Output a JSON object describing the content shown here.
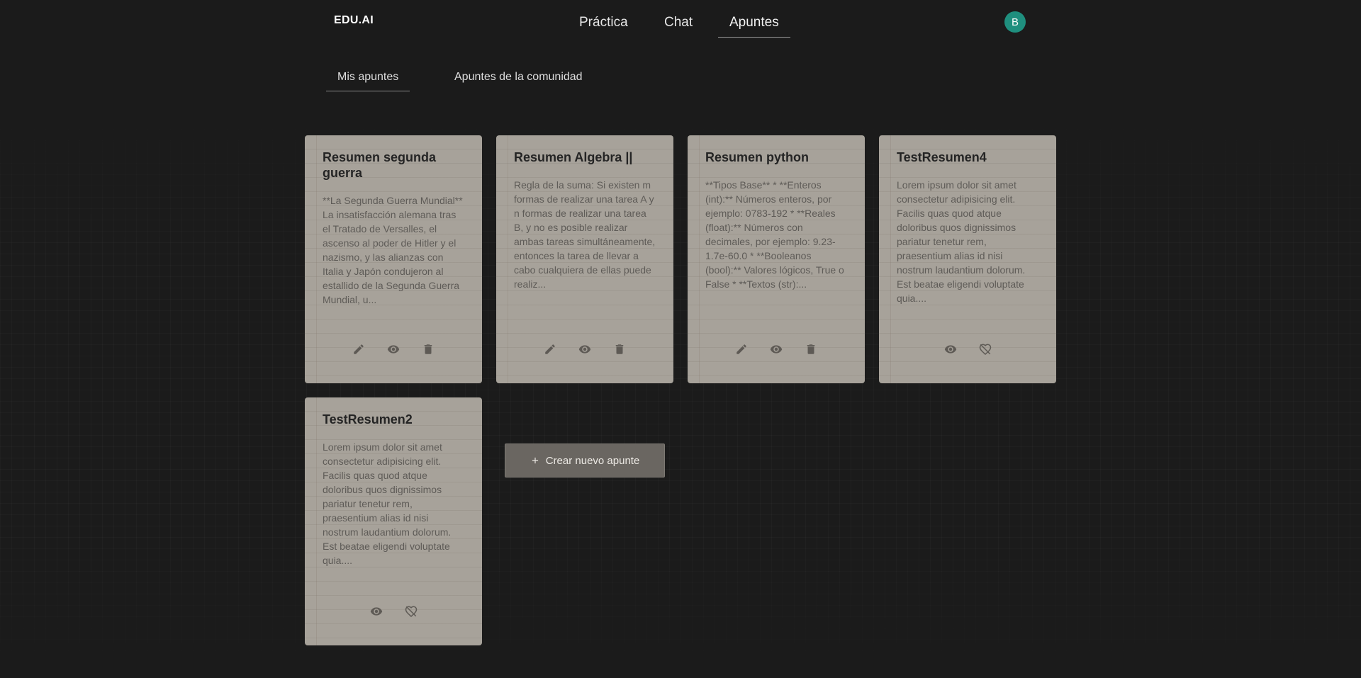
{
  "header": {
    "logo": "EDU.AI",
    "nav": [
      {
        "label": "Práctica"
      },
      {
        "label": "Chat"
      },
      {
        "label": "Apuntes"
      }
    ],
    "active_nav": "Apuntes",
    "avatar_initial": "B"
  },
  "tabs": [
    {
      "label": "Mis apuntes"
    },
    {
      "label": "Apuntes de la comunidad"
    }
  ],
  "active_tab": "Mis apuntes",
  "cards": [
    {
      "title": "Resumen segunda guerra",
      "text": "**La Segunda Guerra Mundial** La insatisfacción alemana tras el Tratado de Versalles, el ascenso al poder de Hitler y el nazismo, y las alianzas con Italia y Japón condujeron al estallido de la Segunda Guerra Mundial, u...",
      "actions": [
        "edit-icon",
        "eye-icon",
        "trash-icon"
      ]
    },
    {
      "title": "Resumen Algebra ||",
      "text": "Regla de la suma: Si existen m formas de realizar una tarea A y n formas de realizar una tarea B, y no es posible realizar ambas tareas simultáneamente, entonces la tarea de llevar a cabo cualquiera de ellas puede realiz...",
      "actions": [
        "edit-icon",
        "eye-icon",
        "trash-icon"
      ]
    },
    {
      "title": "Resumen python",
      "text": "**Tipos Base** * **Enteros (int):** Números enteros, por ejemplo: 0783-192 * **Reales (float):** Números con decimales, por ejemplo: 9.23-1.7e-60.0 * **Booleanos (bool):** Valores lógicos, True o False * **Textos (str):...",
      "actions": [
        "edit-icon",
        "eye-icon",
        "trash-icon"
      ]
    },
    {
      "title": "TestResumen4",
      "text": "Lorem ipsum dolor sit amet consectetur adipisicing elit. Facilis quas quod atque doloribus quos dignissimos pariatur tenetur rem, praesentium alias id nisi nostrum laudantium dolorum. Est beatae eligendi voluptate quia....",
      "actions": [
        "eye-icon",
        "unlike-icon"
      ]
    },
    {
      "title": "TestResumen2",
      "text": "Lorem ipsum dolor sit amet consectetur adipisicing elit. Facilis quas quod atque doloribus quos dignissimos pariatur tenetur rem, praesentium alias id nisi nostrum laudantium dolorum. Est beatae eligendi voluptate quia....",
      "actions": [
        "eye-icon",
        "unlike-icon"
      ]
    }
  ],
  "create_button": {
    "label": "Crear nuevo apunte",
    "icon": "plus-icon"
  },
  "colors": {
    "background": "#1b1b1b",
    "card": "#a7a29a",
    "avatar": "#1f8f7e",
    "create_button": "#6a6661"
  }
}
